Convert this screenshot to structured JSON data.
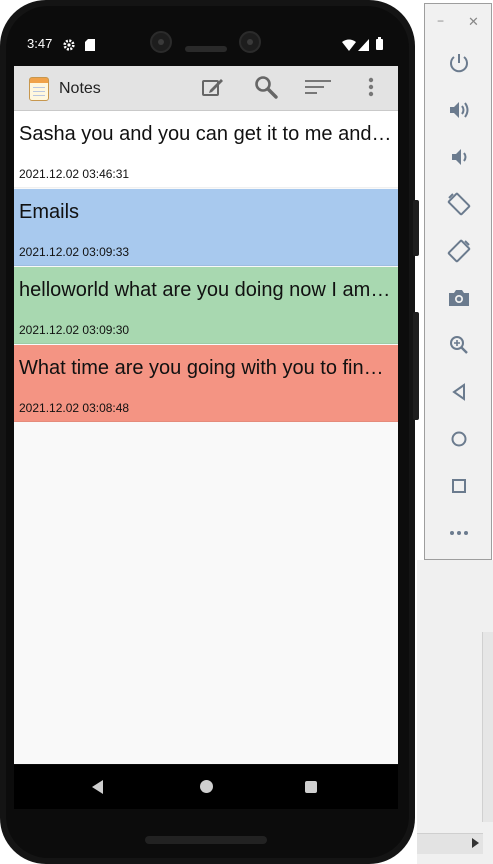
{
  "status_bar": {
    "time": "3:47",
    "icons": [
      "settings-icon",
      "sd-card-icon",
      "wifi-icon",
      "signal-icon",
      "battery-icon"
    ]
  },
  "app_bar": {
    "title": "Notes",
    "actions": [
      "new-note-icon",
      "search-icon",
      "sort-icon",
      "more-vert-icon"
    ]
  },
  "notes": [
    {
      "title": "Sasha you and you can get it to me and I will be there",
      "date": "2021.12.02 03:46:31",
      "color": "#ffffff"
    },
    {
      "title": "Emails",
      "date": "2021.12.02 03:09:33",
      "color": "#a8c9ee"
    },
    {
      "title": "helloworld what are you doing now I am going to be there",
      "date": "2021.12.02 03:09:30",
      "color": "#a8d8b0"
    },
    {
      "title": "What time are you going with you to find out what",
      "date": "2021.12.02 03:08:48",
      "color": "#f49483"
    }
  ],
  "nav_bar": {
    "buttons": [
      "back",
      "home",
      "recents"
    ]
  },
  "emulator_toolbar": {
    "window_controls": {
      "minimize": "−",
      "close": "✕"
    },
    "buttons": [
      "power-icon",
      "volume-up-icon",
      "volume-down-icon",
      "rotate-left-icon",
      "rotate-right-icon",
      "camera-icon",
      "zoom-icon",
      "back-icon",
      "home-icon",
      "overview-icon",
      "more-icon"
    ]
  }
}
